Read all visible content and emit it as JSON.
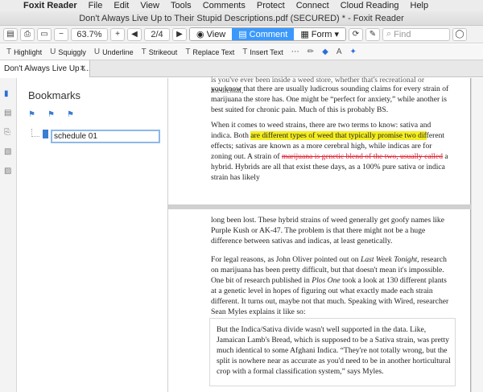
{
  "menubar": {
    "apple": "",
    "items": [
      "Foxit Reader",
      "File",
      "Edit",
      "View",
      "Tools",
      "Comments",
      "Protect",
      "Connect",
      "Cloud Reading",
      "Help"
    ]
  },
  "window": {
    "title": "Don't Always Live Up to Their Stupid Descriptions.pdf (SECURED) * - Foxit Reader"
  },
  "toolbar": {
    "zoom": "63.7%",
    "page": "2/4",
    "view_label": "View",
    "comment_label": "Comment",
    "form_label": "Form",
    "find_placeholder": "Find"
  },
  "comment_tools": [
    "Highlight",
    "Squiggly",
    "Underline",
    "Strikeout",
    "Replace Text",
    "Insert Text"
  ],
  "tab": {
    "label": "Don't Always Live Up t..."
  },
  "bookmarks": {
    "title": "Bookmarks",
    "edit_value": "schedule 01"
  },
  "doc": {
    "p1_top": "is you've ever been inside a weed store, whether that's recreational or medicinal,",
    "p1a": "you know that there are usually ludicrous sounding claims for every strain of marijuana the store has. One might be “perfect for anxiety,” while another is best suited for chronic pain. Much of this is probably BS.",
    "p2_a": "When it comes to weed strains, there are two terms to know: sativa and indica. Both ",
    "p2_hl": "are different types of weed that typically promise two dif",
    "p2_b": "ferent effects; sativas are known as a more cerebral high, while indicas are for zoning out. A strain of ",
    "p2_st": "marijuana is genetic blend of the two, usually called",
    "p2_c": " a hybrid. Hybrids are all that exist these days, as a 100% pure sativa or indica strain has likely",
    "p3": "long been lost. These hybrid strains of weed generally get goofy names like Purple Kush or AK-47. The problem is that there might not be a huge difference between sativas and indicas, at least genetically.",
    "p4_a": "For legal reasons, as John Oliver pointed out on ",
    "p4_i1": "Last Week Tonight",
    "p4_b": ", research on marijuana has been pretty difficult, but that doesn't mean it's impossible. One bit of research published in ",
    "p4_i2": "Plos One",
    "p4_c": " took a look at 130 different plants at a genetic level in hopes of figuring out what exactly made each strain different. It turns out, maybe not that much. Speaking with Wired, researcher Sean Myles explains it like so:",
    "quote": "But the Indica/Sativa divide wasn't well supported in the data. Like, Jamaican Lamb's Bread, which is supposed to be a Sativa strain, was pretty much identical to some Afghani Indica. “They're not totally wrong, but the split is nowhere near as accurate as you'd need to be in another horticultural crop with a formal classification system,” says Myles."
  }
}
